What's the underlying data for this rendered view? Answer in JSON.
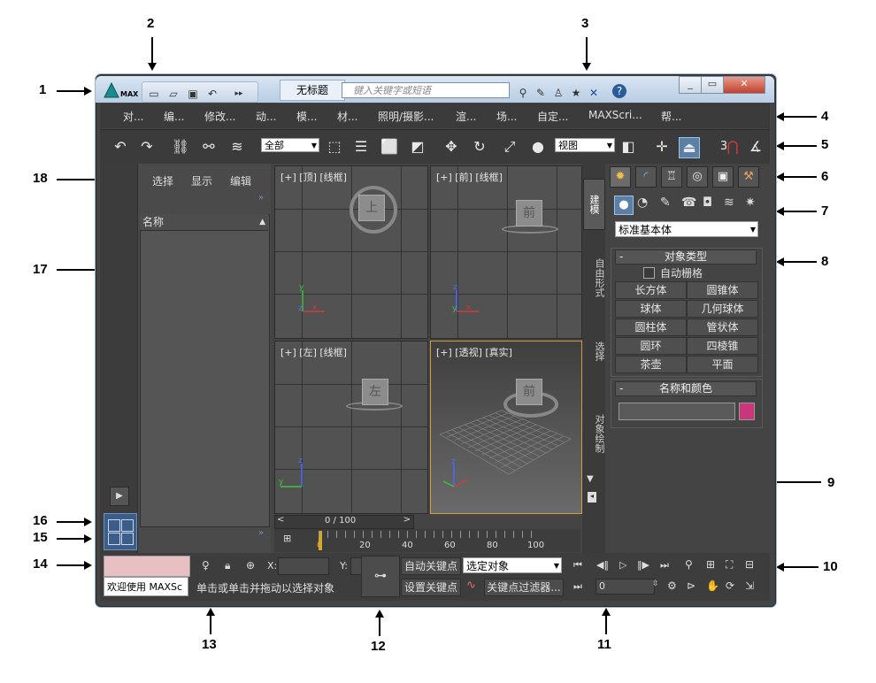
{
  "callouts": [
    "1",
    "2",
    "3",
    "4",
    "5",
    "6",
    "7",
    "8",
    "9",
    "10",
    "11",
    "12",
    "13",
    "14",
    "15",
    "16",
    "17",
    "18"
  ],
  "titlebar": {
    "app_logo": "MAX",
    "document_title": "无标题",
    "search_placeholder": "键入关键字或短语",
    "window_controls": {
      "minimize": "_",
      "restore": "▭",
      "close": "✕"
    }
  },
  "menu": [
    "对...",
    "编...",
    "修改...",
    "动...",
    "模...",
    "材...",
    "照明/摄影...",
    "渲...",
    "场...",
    "自定...",
    "MAXScri...",
    "帮..."
  ],
  "toolbar": {
    "selection_filter": "全部",
    "reference_coord": "视图",
    "snap_label": "3"
  },
  "scene_explorer": {
    "tabs": [
      "选择",
      "显示",
      "编辑"
    ],
    "column_header": "名称"
  },
  "viewports": [
    {
      "label": "[+] [顶] [线框]",
      "cube": "上"
    },
    {
      "label": "[+] [前] [线框]",
      "cube": "前"
    },
    {
      "label": "[+] [左] [线框]",
      "cube": "左"
    },
    {
      "label": "[+] [透视] [真实]",
      "cube": "前"
    }
  ],
  "side_tabs": [
    "建模",
    "自由形式",
    "选择",
    "对象绘制"
  ],
  "time_slider": {
    "label": "0 / 100",
    "ticks": [
      "0",
      "20",
      "40",
      "60",
      "80",
      "100"
    ]
  },
  "command_panel": {
    "category_dropdown": "标准基本体",
    "object_type_title": "对象类型",
    "autogrid_label": "自动栅格",
    "object_buttons": [
      "长方体",
      "圆锥体",
      "球体",
      "几何球体",
      "圆柱体",
      "管状体",
      "圆环",
      "四棱锥",
      "茶壶",
      "平面"
    ],
    "name_color_title": "名称和颜色",
    "color_swatch": "#c8377a"
  },
  "status": {
    "maxscript_text": "欢迎使用 MAXSc",
    "prompt_text": "单击或单击并拖动以选择对象",
    "x_label": "X:",
    "y_label": "Y:",
    "auto_key": "自动关键点",
    "set_key": "设置关键点",
    "selected_dropdown": "选定对象",
    "key_filters": "关键点过滤器...",
    "frame_value": "0"
  }
}
